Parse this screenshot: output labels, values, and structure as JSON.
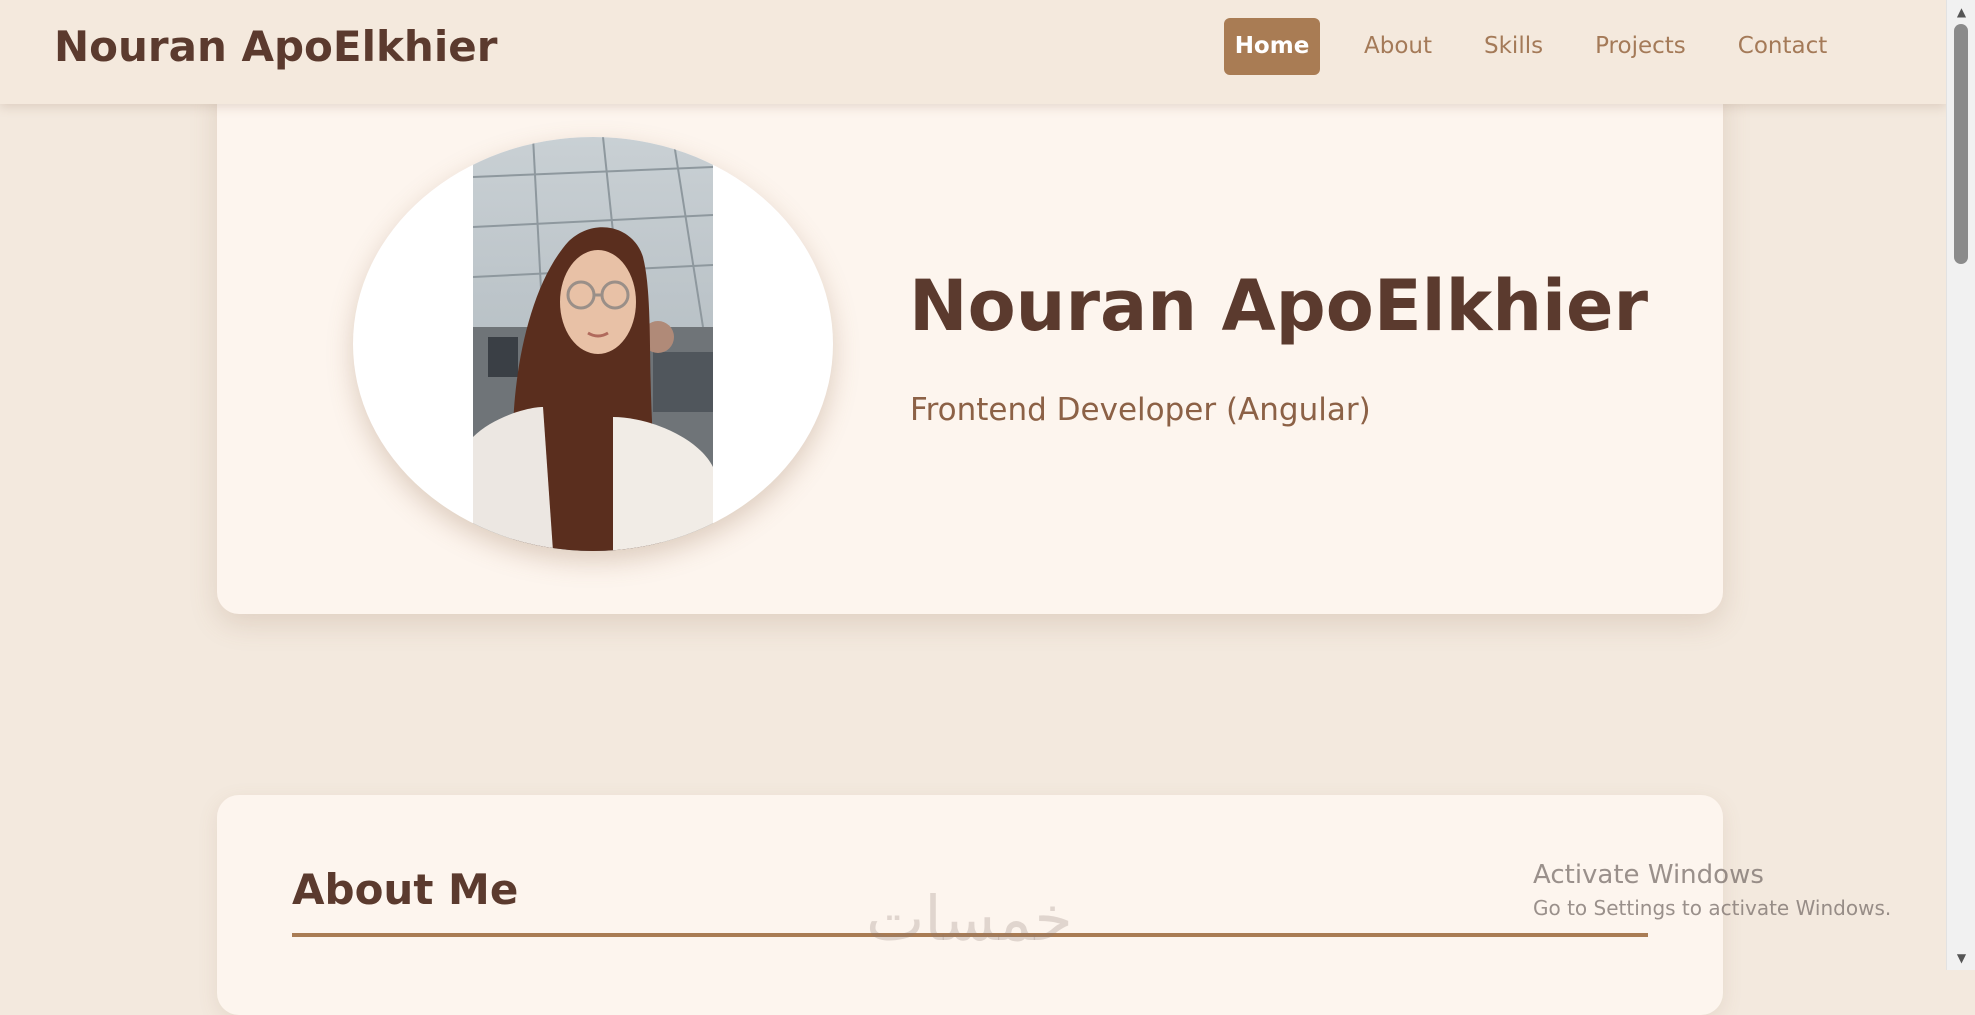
{
  "navbar": {
    "brand": "Nouran ApoElkhier",
    "links": [
      {
        "label": "Home",
        "active": true
      },
      {
        "label": "About",
        "active": false
      },
      {
        "label": "Skills",
        "active": false
      },
      {
        "label": "Projects",
        "active": false
      },
      {
        "label": "Contact",
        "active": false
      }
    ]
  },
  "hero": {
    "name": "Nouran ApoElkhier",
    "role": "Frontend Developer (Angular)",
    "avatar_icon": "profile-photo"
  },
  "about": {
    "title": "About Me"
  },
  "overlay": {
    "watermark": "خمسات",
    "activate_title": "Activate Windows",
    "activate_subtitle": "Go to Settings to activate Windows."
  },
  "colors": {
    "page_bg": "#f3e9de",
    "card_bg": "#fdf5ee",
    "accent": "#a97c54",
    "heading": "#5b3a2e",
    "nav_text": "#a47a58"
  }
}
